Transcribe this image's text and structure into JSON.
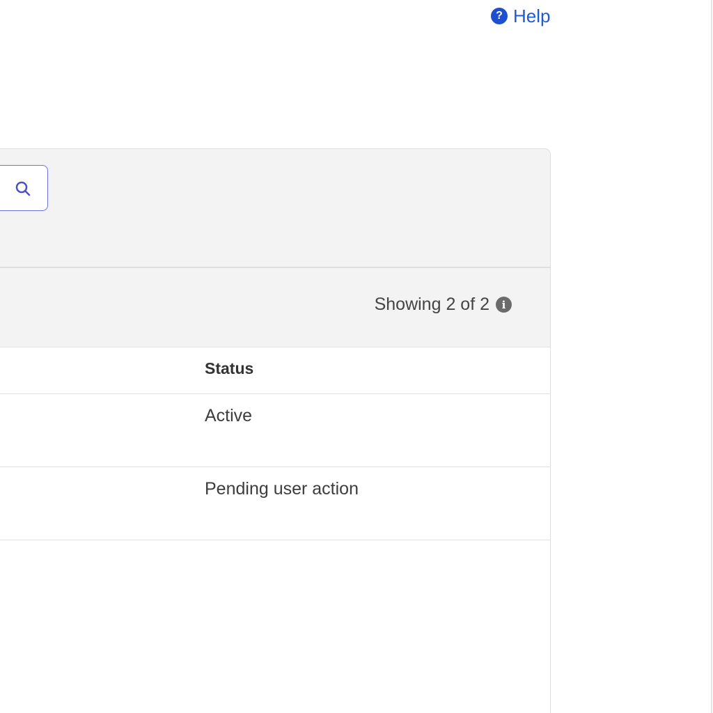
{
  "header": {
    "help_label": "Help",
    "help_icon": "question-circle-icon"
  },
  "toolbar": {
    "search_icon": "search-icon"
  },
  "summary": {
    "showing_text": "Showing 2 of 2",
    "info_icon": "info-circle-icon"
  },
  "table": {
    "columns": {
      "status": "Status"
    },
    "rows": [
      {
        "status": "Active"
      },
      {
        "status": "Pending user action"
      }
    ]
  },
  "colors": {
    "link": "#1f5ad6",
    "search_border": "#6d72dc",
    "panel_background": "#f3f3f3",
    "border": "#dedede"
  }
}
